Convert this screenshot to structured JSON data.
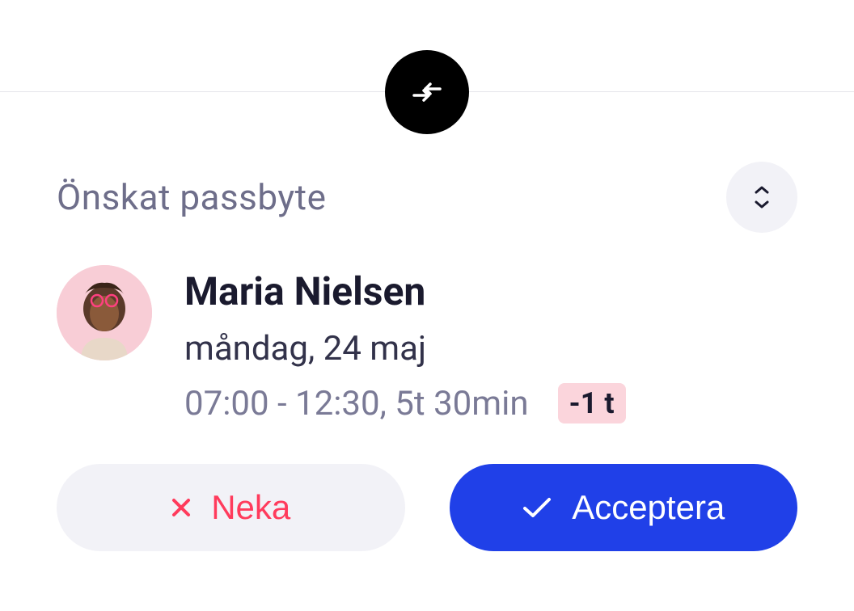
{
  "section_title": "Önskat passbyte",
  "person": {
    "name": "Maria Nielsen",
    "date": "måndag, 24 maj",
    "time": "07:00 - 12:30, 5t 30min",
    "diff": "-1 t"
  },
  "buttons": {
    "decline": "Neka",
    "accept": "Acceptera"
  }
}
